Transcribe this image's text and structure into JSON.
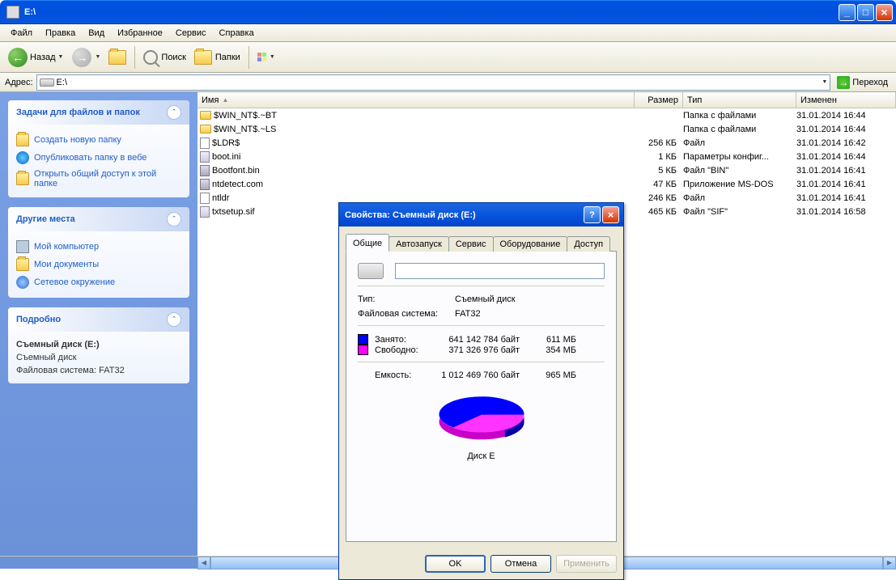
{
  "window": {
    "title": "E:\\"
  },
  "menu": {
    "file": "Файл",
    "edit": "Правка",
    "view": "Вид",
    "favorites": "Избранное",
    "tools": "Сервис",
    "help": "Справка"
  },
  "toolbar": {
    "back": "Назад",
    "search": "Поиск",
    "folders": "Папки"
  },
  "address": {
    "label": "Адрес:",
    "value": "E:\\",
    "go": "Переход"
  },
  "columns": {
    "name": "Имя",
    "size": "Размер",
    "type": "Тип",
    "modified": "Изменен"
  },
  "files": [
    {
      "icon": "folder",
      "name": "$WIN_NT$.~BT",
      "size": "",
      "type": "Папка с файлами",
      "modified": "31.01.2014 16:44"
    },
    {
      "icon": "folder",
      "name": "$WIN_NT$.~LS",
      "size": "",
      "type": "Папка с файлами",
      "modified": "31.01.2014 16:44"
    },
    {
      "icon": "file",
      "name": "$LDR$",
      "size": "256 КБ",
      "type": "Файл",
      "modified": "31.01.2014 16:42"
    },
    {
      "icon": "ini",
      "name": "boot.ini",
      "size": "1 КБ",
      "type": "Параметры конфиг...",
      "modified": "31.01.2014 16:44"
    },
    {
      "icon": "sys",
      "name": "Bootfont.bin",
      "size": "5 КБ",
      "type": "Файл \"BIN\"",
      "modified": "31.01.2014 16:41"
    },
    {
      "icon": "sys",
      "name": "ntdetect.com",
      "size": "47 КБ",
      "type": "Приложение MS-DOS",
      "modified": "31.01.2014 16:41"
    },
    {
      "icon": "file",
      "name": "ntldr",
      "size": "246 КБ",
      "type": "Файл",
      "modified": "31.01.2014 16:41"
    },
    {
      "icon": "ini",
      "name": "txtsetup.sif",
      "size": "465 КБ",
      "type": "Файл \"SIF\"",
      "modified": "31.01.2014 16:58"
    }
  ],
  "sidebar": {
    "tasks": {
      "title": "Задачи для файлов и папок",
      "items": [
        "Создать новую папку",
        "Опубликовать папку в вебе",
        "Открыть общий доступ к этой папке"
      ]
    },
    "places": {
      "title": "Другие места",
      "items": [
        "Мой компьютер",
        "Мои документы",
        "Сетевое окружение"
      ]
    },
    "details": {
      "title": "Подробно",
      "name": "Съемный диск (E:)",
      "type": "Съемный диск",
      "fs": "Файловая система: FAT32"
    }
  },
  "dialog": {
    "title": "Свойства: Съемный диск (E:)",
    "tabs": {
      "general": "Общие",
      "autorun": "Автозапуск",
      "service": "Сервис",
      "hardware": "Оборудование",
      "access": "Доступ"
    },
    "type_label": "Тип:",
    "type_value": "Съемный диск",
    "fs_label": "Файловая система:",
    "fs_value": "FAT32",
    "used_label": "Занято:",
    "used_bytes": "641 142 784 байт",
    "used_mb": "611 МБ",
    "free_label": "Свободно:",
    "free_bytes": "371 326 976 байт",
    "free_mb": "354 МБ",
    "cap_label": "Емкость:",
    "cap_bytes": "1 012 469 760 байт",
    "cap_mb": "965 МБ",
    "disk_label": "Диск E",
    "ok": "OK",
    "cancel": "Отмена",
    "apply": "Применить"
  },
  "chart_data": {
    "type": "pie",
    "title": "Диск E",
    "series": [
      {
        "name": "Занято",
        "value": 641142784,
        "color": "#0000ff"
      },
      {
        "name": "Свободно",
        "value": 371326976,
        "color": "#ff00ff"
      }
    ]
  }
}
